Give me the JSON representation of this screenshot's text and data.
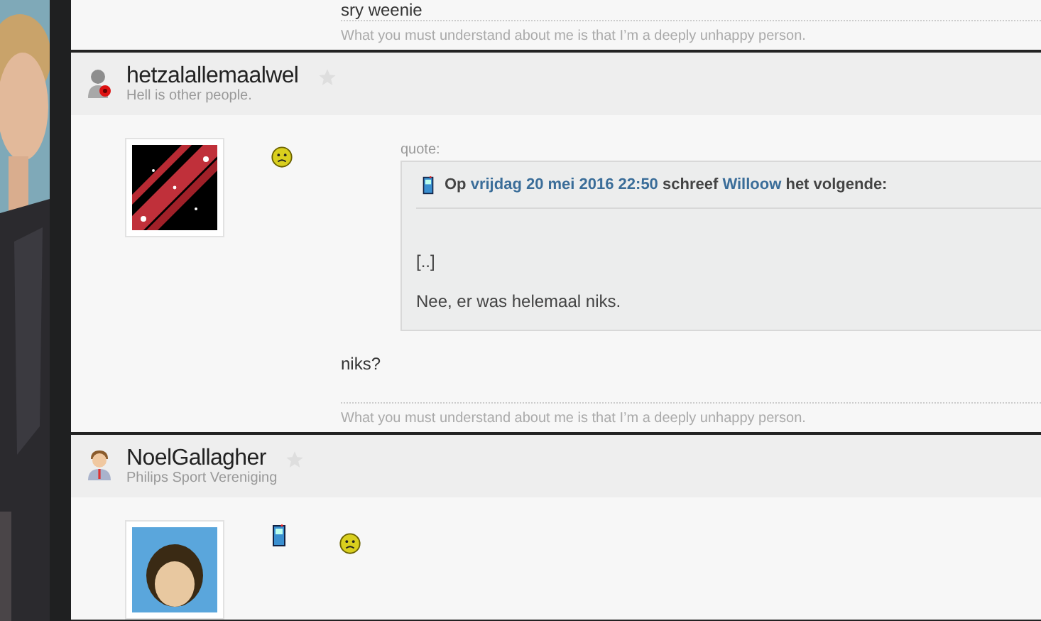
{
  "posts": [
    {
      "kind": "tail",
      "message": "sry weenie",
      "signature": "What you must understand about me is that I’m a deeply unhappy person."
    },
    {
      "kind": "full",
      "user": {
        "name": "hetzalallemaalwel",
        "subtitle": "Hell is other people.",
        "kind": "blocked"
      },
      "avatar": {
        "kind": "artwork"
      },
      "device": false,
      "quote": {
        "label": "quote:",
        "header": [
          {
            "kind": "plain",
            "text": "Op"
          },
          {
            "kind": "link",
            "text": "vrijdag 20 mei 2016 22:50"
          },
          {
            "kind": "plain",
            "text": "schreef"
          },
          {
            "kind": "link",
            "text": "Willoow"
          },
          {
            "kind": "plain",
            "text": "het volgende:"
          }
        ],
        "lines": [
          "[..]",
          "Nee, er was helemaal niks."
        ]
      },
      "message": "niks?",
      "signature": "What you must understand about me is that I’m a deeply unhappy person."
    },
    {
      "kind": "full",
      "user": {
        "name": "NoelGallagher",
        "subtitle": "Philips Sport Vereniging",
        "kind": "male"
      },
      "device": true
    }
  ]
}
